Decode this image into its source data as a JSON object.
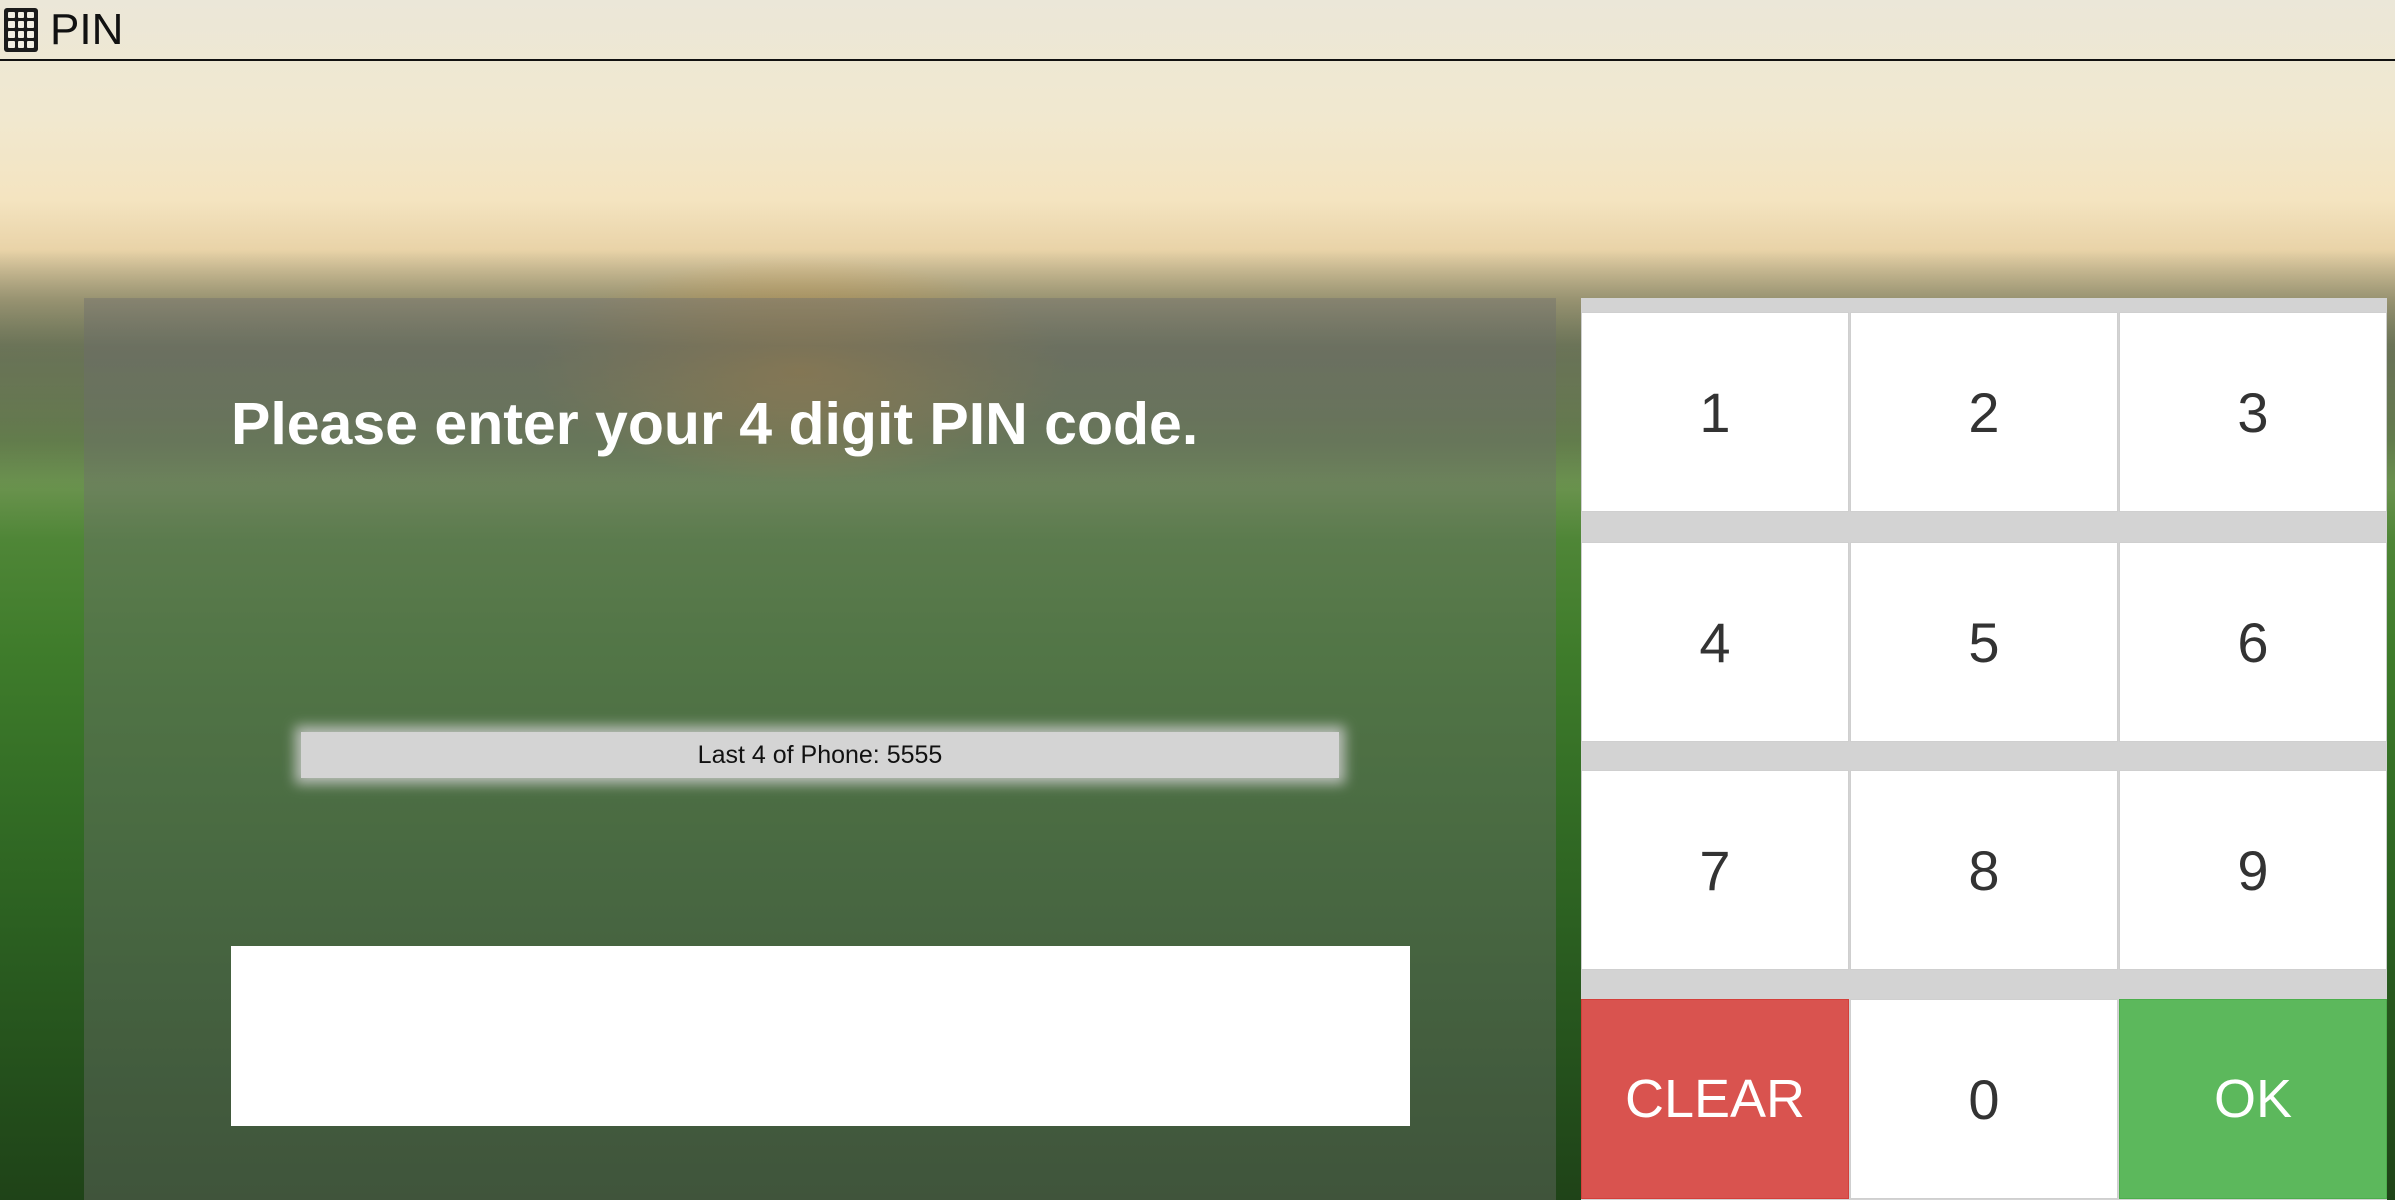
{
  "app": {
    "title": "PIN",
    "icon": "keypad-icon"
  },
  "prompt": {
    "text": "Please enter your 4 digit PIN code."
  },
  "phone_hint": {
    "text": "Last 4 of Phone: 5555"
  },
  "pin_input": {
    "value": ""
  },
  "keypad": {
    "keys": [
      {
        "label": "1"
      },
      {
        "label": "2"
      },
      {
        "label": "3"
      },
      {
        "label": "4"
      },
      {
        "label": "5"
      },
      {
        "label": "6"
      },
      {
        "label": "7"
      },
      {
        "label": "8"
      },
      {
        "label": "9"
      },
      {
        "label": "CLEAR"
      },
      {
        "label": "0"
      },
      {
        "label": "OK"
      }
    ]
  },
  "colors": {
    "clear_button": "#d9534f",
    "ok_button": "#5cb85c",
    "key_background": "#ffffff",
    "keypad_gutter": "#d3d3d3"
  }
}
